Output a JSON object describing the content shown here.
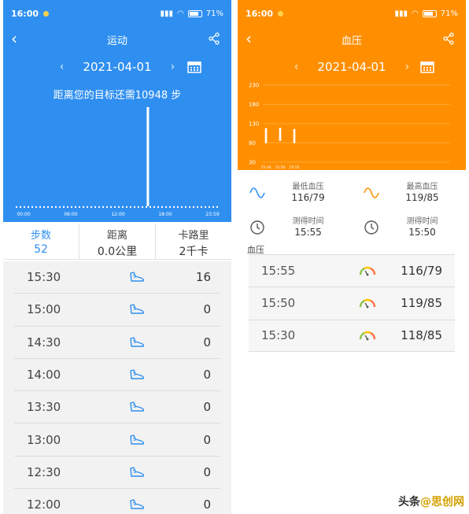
{
  "left": {
    "status": {
      "time": "16:00",
      "battery": "71%"
    },
    "title": "运动",
    "date": "2021-04-01",
    "goal_text": "距离您的目标还需10948 步",
    "chart_data": {
      "type": "bar",
      "x_tick_labels": [
        "00:00",
        "06:00",
        "12:00",
        "18:00",
        "23:59"
      ],
      "bar_hour": 15.5,
      "bar_value": 1,
      "ylim": [
        0,
        1
      ]
    },
    "summary": [
      {
        "label": "步数",
        "value": "52",
        "active": true
      },
      {
        "label": "距离",
        "value": "0.0公里",
        "active": false
      },
      {
        "label": "卡路里",
        "value": "2千卡",
        "active": false
      }
    ],
    "rows": [
      {
        "time": "15:30",
        "value": "16"
      },
      {
        "time": "15:00",
        "value": "0"
      },
      {
        "time": "14:30",
        "value": "0"
      },
      {
        "time": "14:00",
        "value": "0"
      },
      {
        "time": "13:30",
        "value": "0"
      },
      {
        "time": "13:00",
        "value": "0"
      },
      {
        "time": "12:30",
        "value": "0"
      },
      {
        "time": "12:00",
        "value": "0"
      }
    ],
    "colors": {
      "accent": "#2f8ff0"
    }
  },
  "right": {
    "status": {
      "time": "16:00",
      "battery": "71%"
    },
    "title": "血压",
    "date": "2021-04-01",
    "chart_data": {
      "type": "bar",
      "y_ticks": [
        230,
        180,
        130,
        80,
        30
      ],
      "ylim": [
        30,
        230
      ],
      "x_tick_labels": [
        "15:30",
        "15:50",
        "15:55"
      ],
      "series": [
        {
          "low": 79,
          "high": 118
        },
        {
          "low": 85,
          "high": 119
        },
        {
          "low": 79,
          "high": 116
        }
      ]
    },
    "cards": {
      "lowest_label": "最低血压",
      "lowest_value": "116/79",
      "highest_label": "最高血压",
      "highest_value": "119/85",
      "time1_label": "测得时间",
      "time1_value": "15:55",
      "time2_label": "测得时间",
      "time2_value": "15:50"
    },
    "section_label": "血压",
    "rows": [
      {
        "time": "15:55",
        "value": "116/79"
      },
      {
        "time": "15:50",
        "value": "119/85"
      },
      {
        "time": "15:30",
        "value": "118/85"
      }
    ],
    "colors": {
      "accent": "#ff8f00"
    }
  },
  "watermark": {
    "part1": "头条",
    "part2": "@思创网"
  }
}
